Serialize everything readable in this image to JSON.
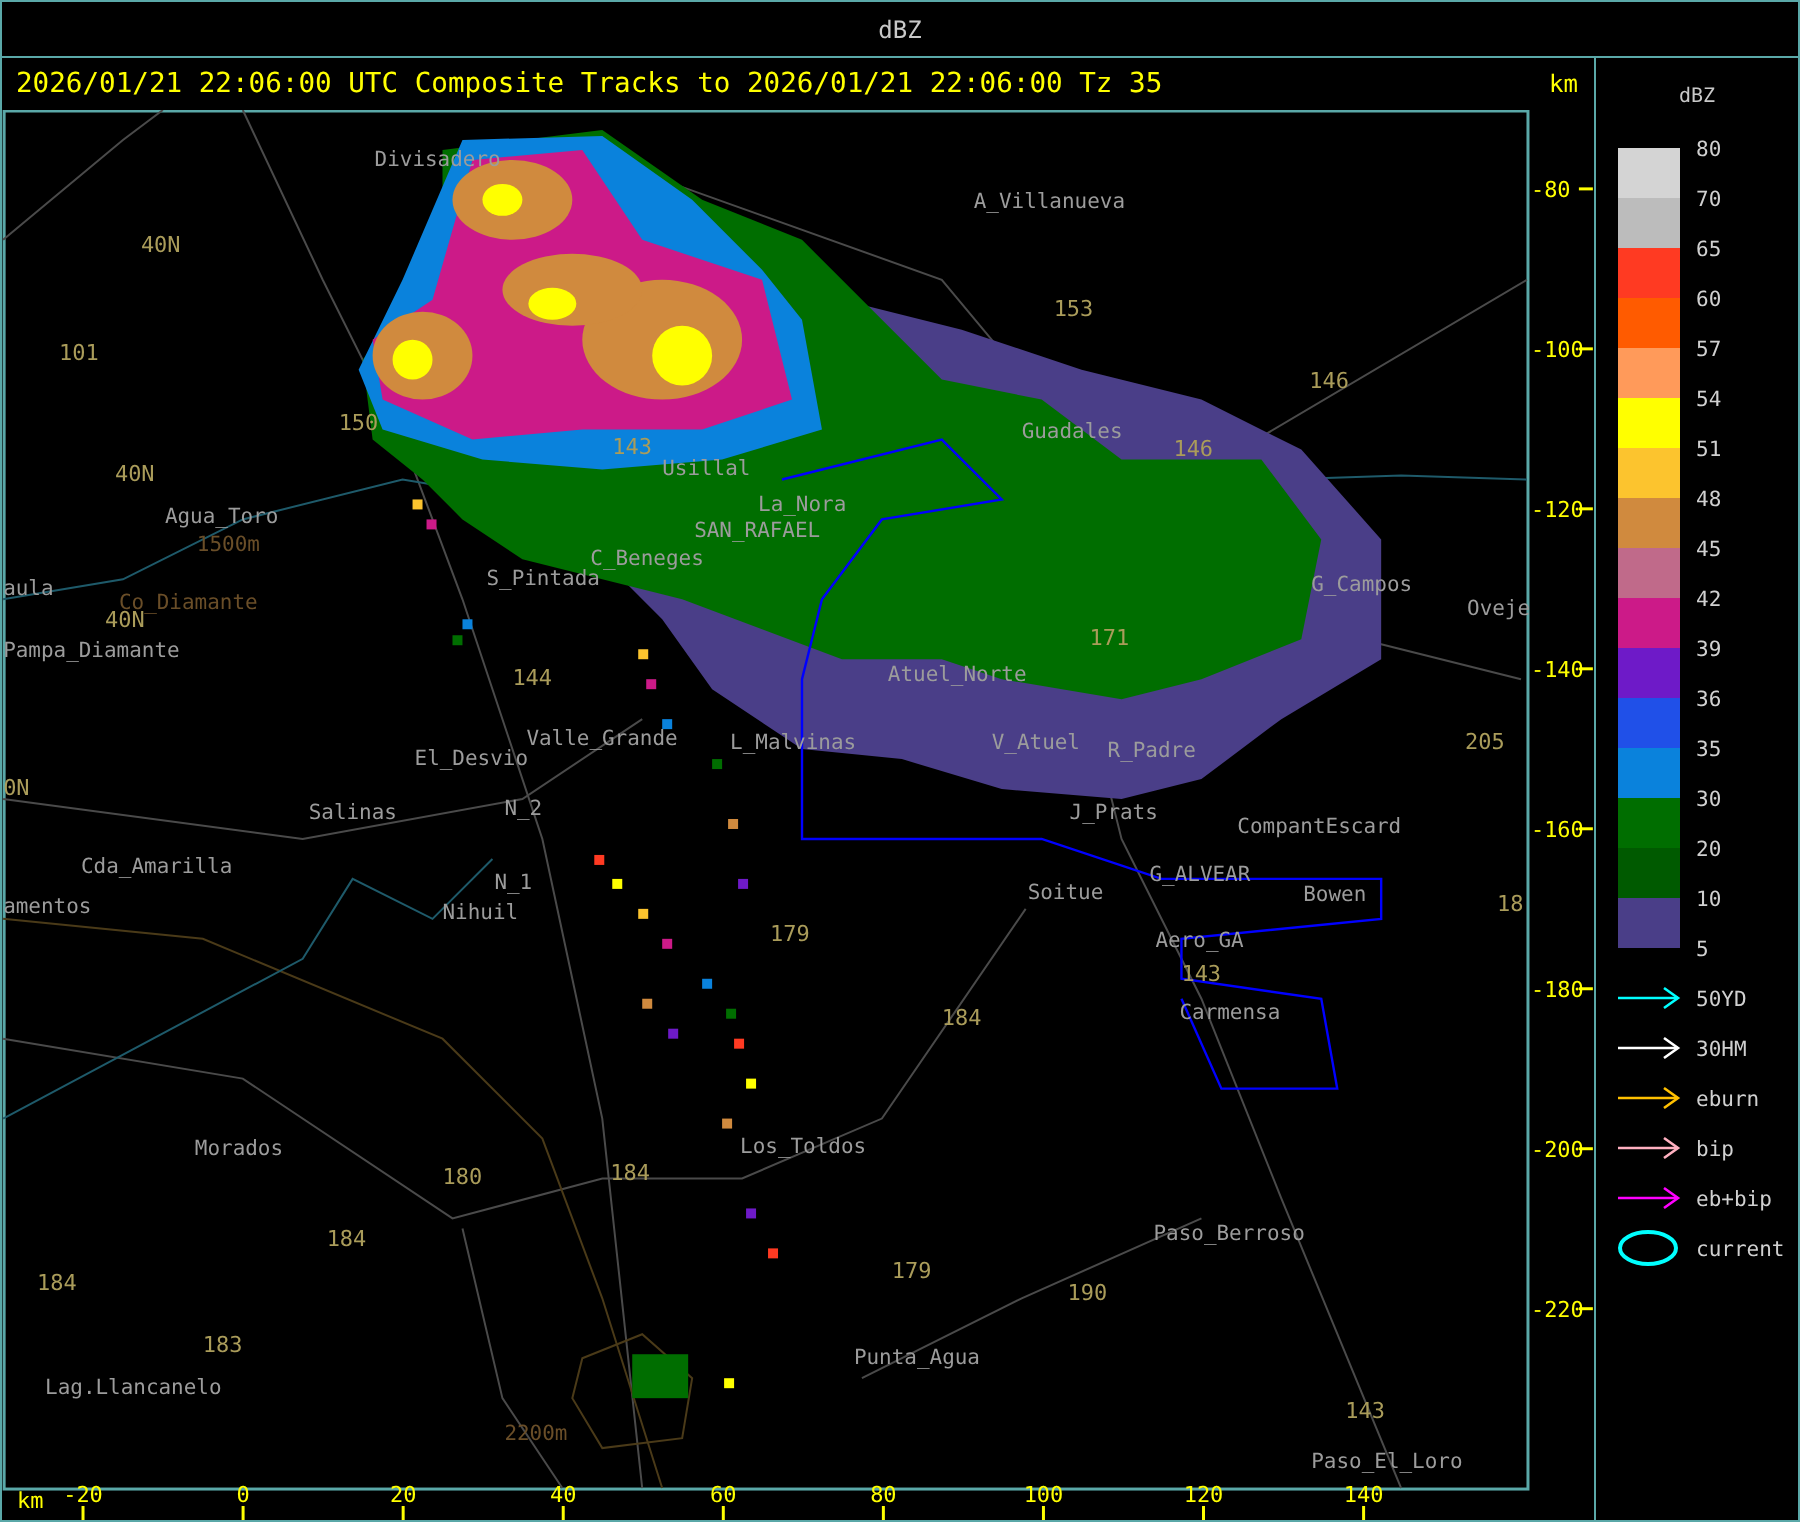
{
  "window": {
    "title": "dBZ"
  },
  "map": {
    "title": "2026/01/21 22:06:00 UTC Composite Tracks to 2026/01/21 22:06:00 Tz 35",
    "y_unit": "km",
    "x_unit": "km",
    "y_ticks": [
      "-80",
      "-100",
      "-120",
      "-140",
      "-160",
      "-180",
      "-200",
      "-220"
    ],
    "x_ticks": [
      "-20",
      "0",
      "20",
      "40",
      "60",
      "80",
      "100",
      "120",
      "140"
    ],
    "places": [
      "Divisadero",
      "A_Villanueva",
      "Agua_Toro",
      "Pampa_Diamante",
      "Salinas",
      "Cda_Amarilla",
      "amentos",
      "El_Desvio",
      "Valle_Grande",
      "N_2",
      "N_1",
      "Nihuil",
      "L_Malvinas",
      "Usillal",
      "La_Nora",
      "SAN_RAFAEL",
      "C_Beneges",
      "S_Pintada",
      "Guadales",
      "G_Campos",
      "Oveje",
      "Atuel_Norte",
      "V_Atuel",
      "R_Padre",
      "J_Prats",
      "CompantEscard",
      "G_ALVEAR",
      "Soitue",
      "Bowen",
      "Aero_GA",
      "Carmensa",
      "Morados",
      "Los_Toldos",
      "Paso_Berroso",
      "Punta_Agua",
      "Lag.Llancanelo",
      "Paso_El_Loro",
      "aula"
    ],
    "contours": [
      "1500m",
      "Co_Diamante",
      "2200m"
    ],
    "routes": [
      "40N",
      "101",
      "40N",
      "40N",
      "150",
      "143",
      "153",
      "146",
      "146",
      "171",
      "144",
      "180",
      "184",
      "184",
      "184",
      "183",
      "179",
      "179",
      "190",
      "143",
      "143",
      "205",
      "18",
      "184",
      "0N"
    ]
  },
  "legend": {
    "title": "dBZ",
    "bins": [
      {
        "color": "#d4d4d4"
      },
      {
        "color": "#bcbcbc"
      },
      {
        "color": "#ff3a22"
      },
      {
        "color": "#ff5b00"
      },
      {
        "color": "#ff9a5a"
      },
      {
        "color": "#ffff00"
      },
      {
        "color": "#fcc42e"
      },
      {
        "color": "#d08a3e"
      },
      {
        "color": "#c06a8a"
      },
      {
        "color": "#cc1a88"
      },
      {
        "color": "#6e1ac8"
      },
      {
        "color": "#2050e8"
      },
      {
        "color": "#0a82dc"
      },
      {
        "color": "#006e00"
      },
      {
        "color": "#005a00"
      },
      {
        "color": "#4a3e88"
      }
    ],
    "values": [
      "80",
      "70",
      "65",
      "60",
      "57",
      "54",
      "51",
      "48",
      "45",
      "42",
      "39",
      "36",
      "35",
      "30",
      "20",
      "10",
      "5"
    ],
    "tracks": [
      {
        "kind": "arrow",
        "label": "50YD",
        "color": "#00ffff"
      },
      {
        "kind": "arrow",
        "label": "30HM",
        "color": "#ffffff"
      },
      {
        "kind": "arrow",
        "label": "eburn",
        "color": "#ffc000"
      },
      {
        "kind": "arrow",
        "label": "bip",
        "color": "#ffb0c0"
      },
      {
        "kind": "arrow",
        "label": "eb+bip",
        "color": "#ff00ff"
      },
      {
        "kind": "ellipse",
        "label": "current",
        "color": "#00ffff"
      }
    ]
  }
}
